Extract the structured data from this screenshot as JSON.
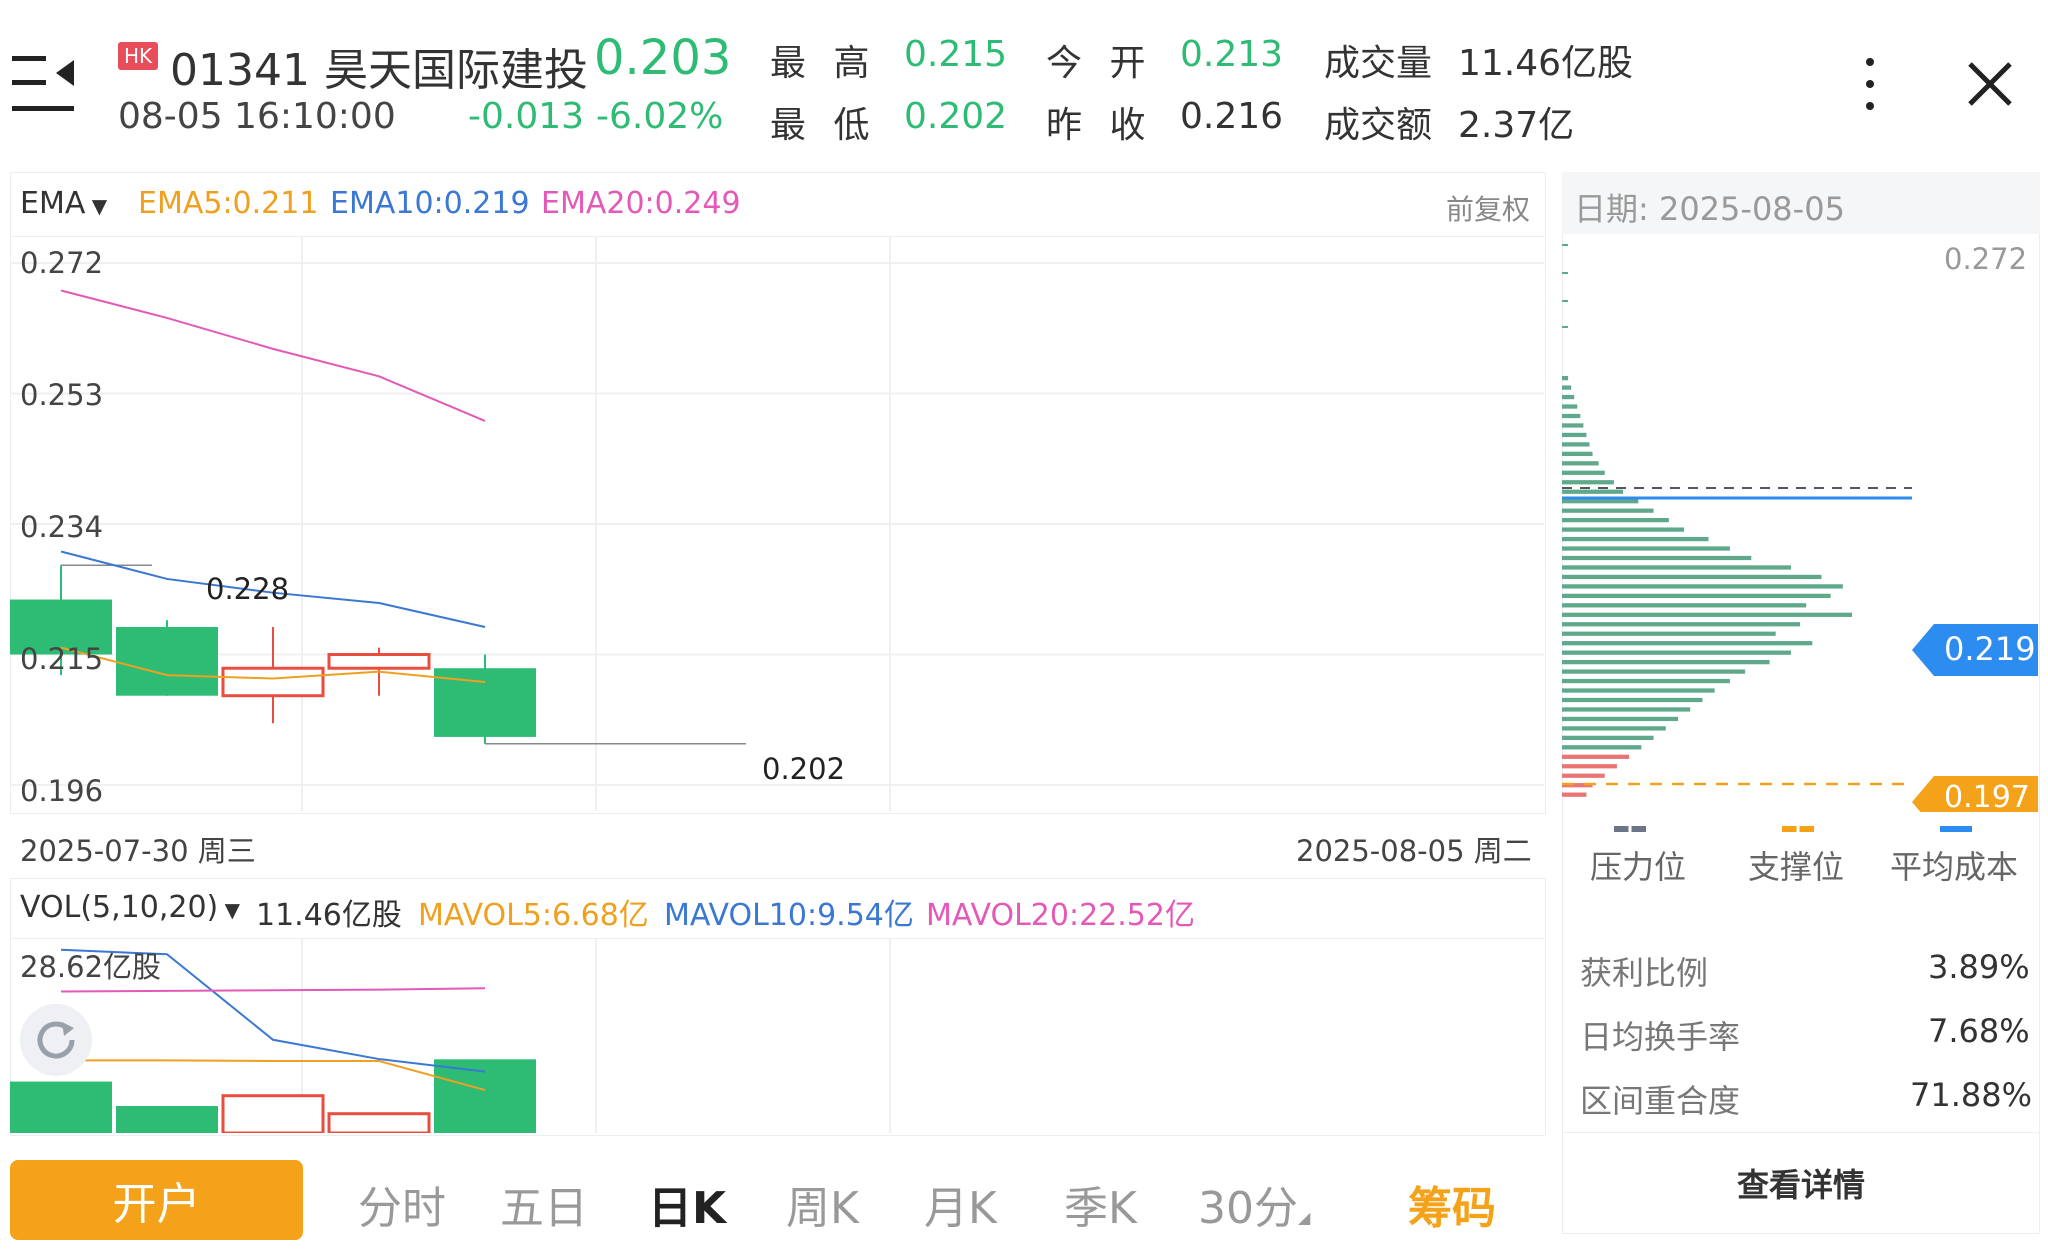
{
  "header": {
    "market_badge": "HK",
    "code": "01341",
    "name": "昊天国际建投",
    "price": "0.203",
    "datetime": "08-05 16:10:00",
    "change": "-0.013",
    "change_pct": "-6.02%",
    "stats": {
      "high_label": "最 高",
      "high_value": "0.215",
      "open_label": "今 开",
      "open_value": "0.213",
      "volume_label": "成交量",
      "volume_value": "11.46亿股",
      "low_label": "最 低",
      "low_value": "0.202",
      "prev_close_label": "昨 收",
      "prev_close_value": "0.216",
      "amount_label": "成交额",
      "amount_value": "2.37亿"
    }
  },
  "ema_bar": {
    "indicator": "EMA",
    "ema5": "EMA5:0.211",
    "ema10": "EMA10:0.219",
    "ema20": "EMA20:0.249",
    "adjust": "前复权",
    "colors": {
      "ema5": "#f0a020",
      "ema10": "#3a78d4",
      "ema20": "#e458b8"
    }
  },
  "price_axis": [
    "0.272",
    "0.253",
    "0.234",
    "0.215",
    "0.196"
  ],
  "annotations": {
    "high": "0.228",
    "low": "0.202"
  },
  "date_range": {
    "start": "2025-07-30 周三",
    "end": "2025-08-05 周二"
  },
  "vol_bar": {
    "indicator": "VOL(5,10,20)",
    "volume": "11.46亿股",
    "mavol5": "MAVOL5:6.68亿",
    "mavol10": "MAVOL10:9.54亿",
    "mavol20": "MAVOL20:22.52亿",
    "max_label": "28.62亿股"
  },
  "chart_data": {
    "type": "candlestick",
    "price_range": [
      0.196,
      0.272
    ],
    "candles": [
      {
        "open": 0.215,
        "close": 0.223,
        "high": 0.228,
        "low": 0.212,
        "dir": "down"
      },
      {
        "open": 0.219,
        "close": 0.209,
        "high": 0.22,
        "low": 0.209,
        "dir": "down"
      },
      {
        "open": 0.209,
        "close": 0.213,
        "high": 0.219,
        "low": 0.205,
        "dir": "up"
      },
      {
        "open": 0.213,
        "close": 0.215,
        "high": 0.216,
        "low": 0.209,
        "dir": "up"
      },
      {
        "open": 0.213,
        "close": 0.203,
        "high": 0.215,
        "low": 0.202,
        "dir": "down"
      }
    ],
    "ema5": [
      0.216,
      0.212,
      0.2115,
      0.2125,
      0.211
    ],
    "ema10": [
      0.23,
      0.226,
      0.224,
      0.2225,
      0.219
    ],
    "ema20": [
      0.268,
      0.264,
      0.2595,
      0.2555,
      0.249
    ],
    "volume_max": 28.62,
    "volumes": [
      8.0,
      4.2,
      5.8,
      3.0,
      11.46
    ],
    "mavol5": [
      11.3,
      11.3,
      11.2,
      11.2,
      6.68
    ],
    "mavol10": [
      28.5,
      27.8,
      14.5,
      11.5,
      9.54
    ],
    "mavol20": [
      22.0,
      22.1,
      22.2,
      22.3,
      22.52
    ]
  },
  "chips": {
    "date": "日期: 2025-08-05",
    "top": "0.272",
    "avg_cost": "0.219",
    "support": "0.197",
    "legend": [
      "压力位",
      "支撑位",
      "平均成本"
    ],
    "legend_colors": [
      "#6c7488",
      "#f4a21a",
      "#2d8cf0"
    ],
    "stats": [
      {
        "label": "获利比例",
        "value": "3.89%"
      },
      {
        "label": "日均换手率",
        "value": "7.68%"
      },
      {
        "label": "区间重合度",
        "value": "71.88%"
      }
    ],
    "detail": "查看详情",
    "distribution": [
      2,
      3,
      4,
      5,
      6,
      7,
      8,
      9,
      10,
      12,
      14,
      17,
      20,
      25,
      30,
      35,
      40,
      48,
      55,
      62,
      75,
      85,
      92,
      88,
      80,
      95,
      78,
      70,
      82,
      75,
      68,
      60,
      55,
      50,
      46,
      42,
      38,
      34,
      30,
      26,
      22,
      18,
      14,
      10,
      8
    ]
  },
  "tabs": {
    "open_account": "开户",
    "items": [
      "分时",
      "五日",
      "日K",
      "周K",
      "月K",
      "季K",
      "30分"
    ],
    "active": "日K",
    "chip_tab": "筹码"
  }
}
